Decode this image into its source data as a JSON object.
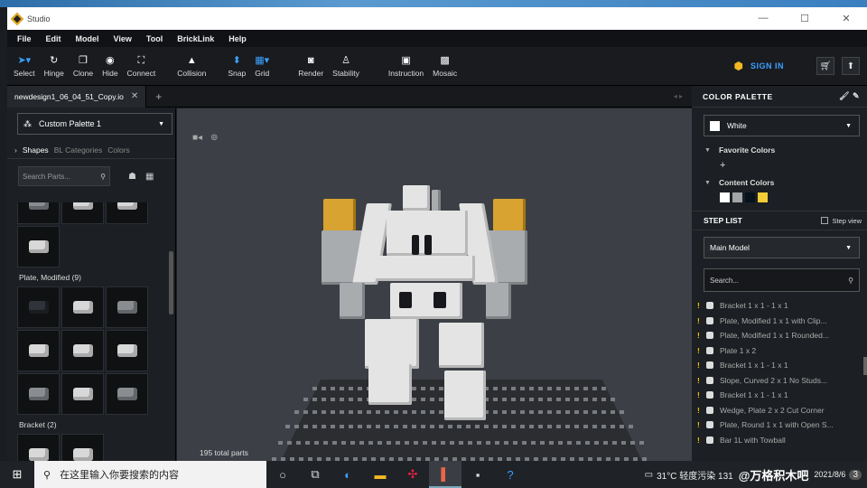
{
  "window": {
    "title": "Studio",
    "controls": [
      "—",
      "☐",
      "✕"
    ]
  },
  "menu": [
    "File",
    "Edit",
    "Model",
    "View",
    "Tool",
    "BrickLink",
    "Help"
  ],
  "toolbar": {
    "tools": [
      {
        "label": "Select",
        "icon": "cursor-icon"
      },
      {
        "label": "Hinge",
        "icon": "hinge-icon"
      },
      {
        "label": "Clone",
        "icon": "clone-icon"
      },
      {
        "label": "Hide",
        "icon": "eye-icon"
      },
      {
        "label": "Connect",
        "icon": "connect-icon"
      },
      {
        "label": "Collision",
        "icon": "warning-icon"
      },
      {
        "label": "Snap",
        "icon": "snap-icon"
      },
      {
        "label": "Grid",
        "icon": "grid-icon"
      },
      {
        "label": "Render",
        "icon": "camera-icon"
      },
      {
        "label": "Stability",
        "icon": "stability-icon"
      },
      {
        "label": "Instruction",
        "icon": "instruction-icon"
      },
      {
        "label": "Mosaic",
        "icon": "mosaic-icon"
      }
    ],
    "sign_in": "SIGN IN"
  },
  "tab": {
    "name": "newdesign1_06_04_51_Copy.io"
  },
  "left_panel": {
    "palette": "Custom Palette 1",
    "tabs": [
      "Shapes",
      "BL Categories",
      "Colors"
    ],
    "search_placeholder": "Search Parts...",
    "sections": [
      {
        "title": "Plate, Modified (9)"
      },
      {
        "title": "Bracket (2)"
      }
    ]
  },
  "viewport": {
    "total_parts": "195 total parts"
  },
  "right_panel": {
    "color_palette_title": "COLOR PALETTE",
    "selected_color": "White",
    "favorite_colors": "Favorite Colors",
    "content_colors": "Content Colors",
    "content_swatches": [
      "#ffffff",
      "#a0a5a9",
      "#05131d",
      "#f2cd37"
    ],
    "step_list_title": "STEP LIST",
    "step_view": "Step view",
    "model": "Main Model",
    "search_placeholder": "Search...",
    "steps": [
      "Bracket 1 x 1 - 1 x 1",
      "Plate, Modified 1 x 1 with Clip...",
      "Plate, Modified 1 x 1 Rounded...",
      "Plate 1 x 2",
      "Bracket 1 x 1 - 1 x 1",
      "Slope, Curved 2 x 1 No Studs...",
      "Bracket 1 x 1 - 1 x 1",
      "Wedge, Plate 2 x 2 Cut Corner",
      "Plate, Round 1 x 1 with Open S...",
      "Bar  1L with Towball"
    ]
  },
  "taskbar": {
    "search_placeholder": "在这里输入你要搜索的内容",
    "weather": "31°C 轻度污染 131",
    "watermark": "@万格积木吧",
    "date": "2021/8/6",
    "badge": "3"
  }
}
